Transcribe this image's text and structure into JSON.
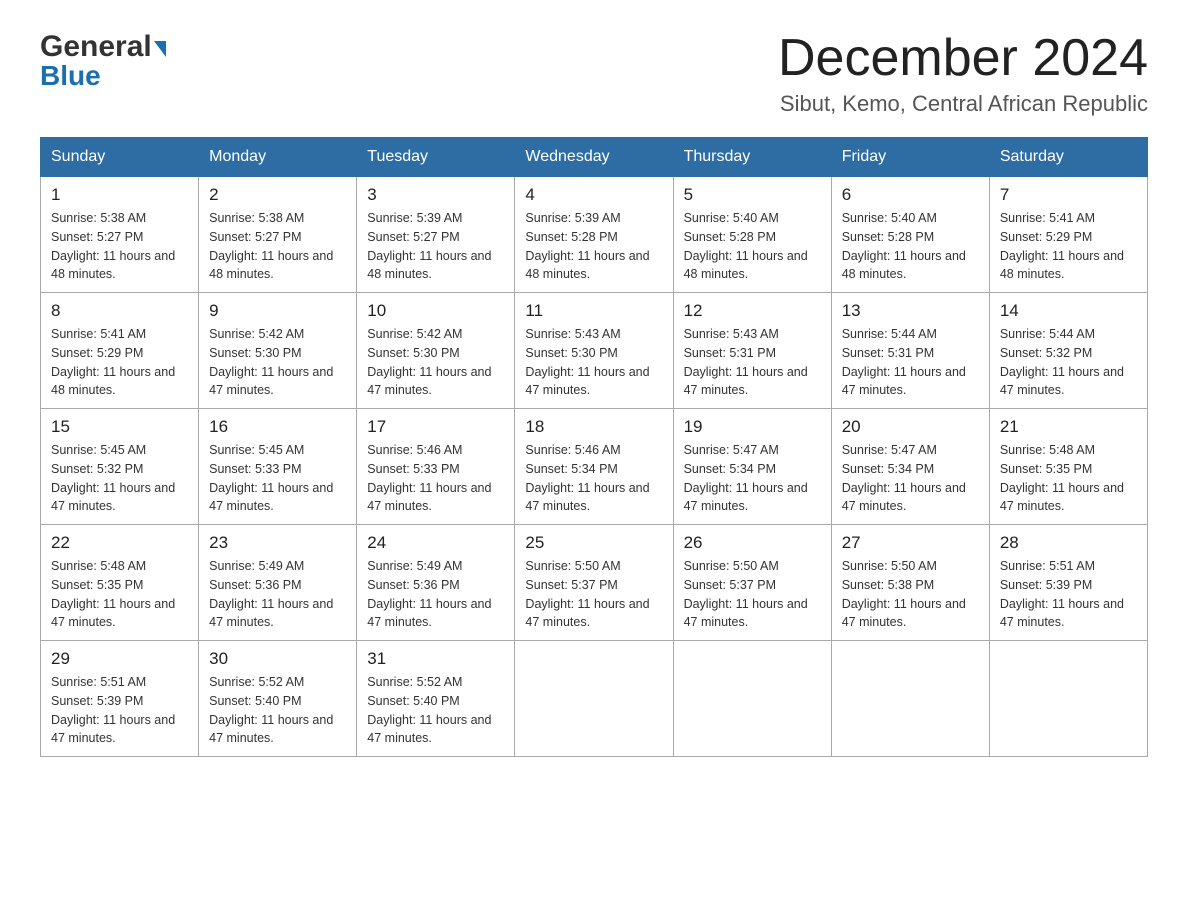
{
  "header": {
    "logo_general": "General",
    "logo_blue": "Blue",
    "month_title": "December 2024",
    "location": "Sibut, Kemo, Central African Republic"
  },
  "days_of_week": [
    "Sunday",
    "Monday",
    "Tuesday",
    "Wednesday",
    "Thursday",
    "Friday",
    "Saturday"
  ],
  "weeks": [
    [
      {
        "day": "1",
        "sunrise": "5:38 AM",
        "sunset": "5:27 PM",
        "daylight": "11 hours and 48 minutes."
      },
      {
        "day": "2",
        "sunrise": "5:38 AM",
        "sunset": "5:27 PM",
        "daylight": "11 hours and 48 minutes."
      },
      {
        "day": "3",
        "sunrise": "5:39 AM",
        "sunset": "5:27 PM",
        "daylight": "11 hours and 48 minutes."
      },
      {
        "day": "4",
        "sunrise": "5:39 AM",
        "sunset": "5:28 PM",
        "daylight": "11 hours and 48 minutes."
      },
      {
        "day": "5",
        "sunrise": "5:40 AM",
        "sunset": "5:28 PM",
        "daylight": "11 hours and 48 minutes."
      },
      {
        "day": "6",
        "sunrise": "5:40 AM",
        "sunset": "5:28 PM",
        "daylight": "11 hours and 48 minutes."
      },
      {
        "day": "7",
        "sunrise": "5:41 AM",
        "sunset": "5:29 PM",
        "daylight": "11 hours and 48 minutes."
      }
    ],
    [
      {
        "day": "8",
        "sunrise": "5:41 AM",
        "sunset": "5:29 PM",
        "daylight": "11 hours and 48 minutes."
      },
      {
        "day": "9",
        "sunrise": "5:42 AM",
        "sunset": "5:30 PM",
        "daylight": "11 hours and 47 minutes."
      },
      {
        "day": "10",
        "sunrise": "5:42 AM",
        "sunset": "5:30 PM",
        "daylight": "11 hours and 47 minutes."
      },
      {
        "day": "11",
        "sunrise": "5:43 AM",
        "sunset": "5:30 PM",
        "daylight": "11 hours and 47 minutes."
      },
      {
        "day": "12",
        "sunrise": "5:43 AM",
        "sunset": "5:31 PM",
        "daylight": "11 hours and 47 minutes."
      },
      {
        "day": "13",
        "sunrise": "5:44 AM",
        "sunset": "5:31 PM",
        "daylight": "11 hours and 47 minutes."
      },
      {
        "day": "14",
        "sunrise": "5:44 AM",
        "sunset": "5:32 PM",
        "daylight": "11 hours and 47 minutes."
      }
    ],
    [
      {
        "day": "15",
        "sunrise": "5:45 AM",
        "sunset": "5:32 PM",
        "daylight": "11 hours and 47 minutes."
      },
      {
        "day": "16",
        "sunrise": "5:45 AM",
        "sunset": "5:33 PM",
        "daylight": "11 hours and 47 minutes."
      },
      {
        "day": "17",
        "sunrise": "5:46 AM",
        "sunset": "5:33 PM",
        "daylight": "11 hours and 47 minutes."
      },
      {
        "day": "18",
        "sunrise": "5:46 AM",
        "sunset": "5:34 PM",
        "daylight": "11 hours and 47 minutes."
      },
      {
        "day": "19",
        "sunrise": "5:47 AM",
        "sunset": "5:34 PM",
        "daylight": "11 hours and 47 minutes."
      },
      {
        "day": "20",
        "sunrise": "5:47 AM",
        "sunset": "5:34 PM",
        "daylight": "11 hours and 47 minutes."
      },
      {
        "day": "21",
        "sunrise": "5:48 AM",
        "sunset": "5:35 PM",
        "daylight": "11 hours and 47 minutes."
      }
    ],
    [
      {
        "day": "22",
        "sunrise": "5:48 AM",
        "sunset": "5:35 PM",
        "daylight": "11 hours and 47 minutes."
      },
      {
        "day": "23",
        "sunrise": "5:49 AM",
        "sunset": "5:36 PM",
        "daylight": "11 hours and 47 minutes."
      },
      {
        "day": "24",
        "sunrise": "5:49 AM",
        "sunset": "5:36 PM",
        "daylight": "11 hours and 47 minutes."
      },
      {
        "day": "25",
        "sunrise": "5:50 AM",
        "sunset": "5:37 PM",
        "daylight": "11 hours and 47 minutes."
      },
      {
        "day": "26",
        "sunrise": "5:50 AM",
        "sunset": "5:37 PM",
        "daylight": "11 hours and 47 minutes."
      },
      {
        "day": "27",
        "sunrise": "5:50 AM",
        "sunset": "5:38 PM",
        "daylight": "11 hours and 47 minutes."
      },
      {
        "day": "28",
        "sunrise": "5:51 AM",
        "sunset": "5:39 PM",
        "daylight": "11 hours and 47 minutes."
      }
    ],
    [
      {
        "day": "29",
        "sunrise": "5:51 AM",
        "sunset": "5:39 PM",
        "daylight": "11 hours and 47 minutes."
      },
      {
        "day": "30",
        "sunrise": "5:52 AM",
        "sunset": "5:40 PM",
        "daylight": "11 hours and 47 minutes."
      },
      {
        "day": "31",
        "sunrise": "5:52 AM",
        "sunset": "5:40 PM",
        "daylight": "11 hours and 47 minutes."
      },
      null,
      null,
      null,
      null
    ]
  ],
  "labels": {
    "sunrise": "Sunrise:",
    "sunset": "Sunset:",
    "daylight": "Daylight:"
  }
}
